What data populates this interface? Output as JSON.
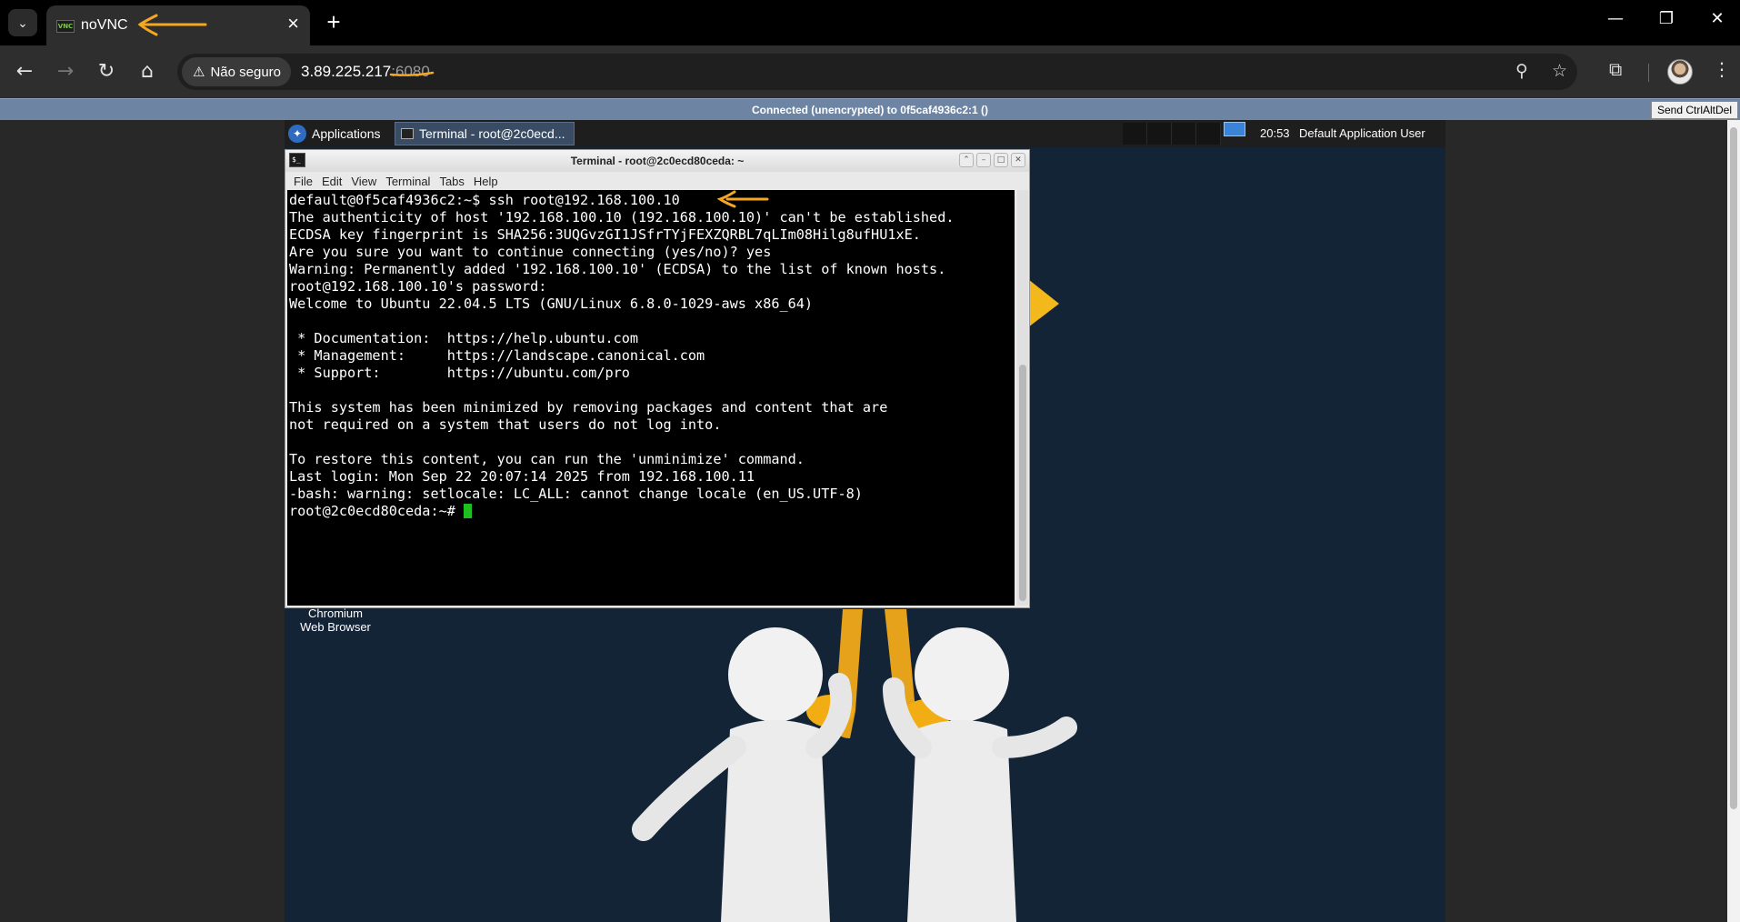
{
  "browser": {
    "tab_title": "noVNC",
    "tab_favicon": "VNC",
    "url_host": "3.89.225.217",
    "url_port": ":6080",
    "security_label": "Não seguro",
    "window_controls": [
      "minimize-icon",
      "restore-icon",
      "close-icon"
    ]
  },
  "novnc": {
    "status": "Connected (unencrypted) to 0f5caf4936c2:1 ()",
    "ctrl_alt_del": "Send CtrlAltDel"
  },
  "panel": {
    "applications": "Applications",
    "task_title": "Terminal - root@2c0ecd...",
    "clock": "20:53",
    "user": "Default Application User"
  },
  "desktop": {
    "icon_label": "Chromium\nWeb Browser"
  },
  "terminal": {
    "title": "Terminal - root@2c0ecd80ceda: ~",
    "menu": [
      "File",
      "Edit",
      "View",
      "Terminal",
      "Tabs",
      "Help"
    ],
    "lines": [
      "default@0f5caf4936c2:~$ ssh root@192.168.100.10",
      "The authenticity of host '192.168.100.10 (192.168.100.10)' can't be established.",
      "ECDSA key fingerprint is SHA256:3UQGvzGI1JSfrTYjFEXZQRBL7qLIm08Hilg8ufHU1xE.",
      "Are you sure you want to continue connecting (yes/no)? yes",
      "Warning: Permanently added '192.168.100.10' (ECDSA) to the list of known hosts.",
      "root@192.168.100.10's password:",
      "Welcome to Ubuntu 22.04.5 LTS (GNU/Linux 6.8.0-1029-aws x86_64)",
      "",
      " * Documentation:  https://help.ubuntu.com",
      " * Management:     https://landscape.canonical.com",
      " * Support:        https://ubuntu.com/pro",
      "",
      "This system has been minimized by removing packages and content that are",
      "not required on a system that users do not log into.",
      "",
      "To restore this content, you can run the 'unminimize' command.",
      "Last login: Mon Sep 22 20:07:14 2025 from 192.168.100.11",
      "-bash: warning: setlocale: LC_ALL: cannot change locale (en_US.UTF-8)"
    ],
    "prompt": "root@2c0ecd80ceda:~# "
  },
  "colors": {
    "annotation": "#f5a623",
    "cursor": "#1fbf1f",
    "novnc_bar": "#6e84a3",
    "desktop_bg": "#142437"
  }
}
